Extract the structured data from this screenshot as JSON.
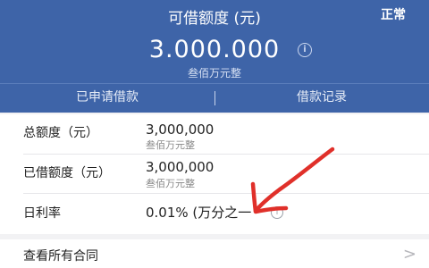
{
  "header": {
    "title": "可借额度 (元)",
    "status": "正常",
    "amount": "3.000.000",
    "amount_words": "叁佰万元整",
    "info_icon": "info-icon"
  },
  "tabs": [
    {
      "label": "已申请借款"
    },
    {
      "label": "借款记录"
    }
  ],
  "details": [
    {
      "label": "总额度（元）",
      "value": "3,000,000",
      "sub": "叁佰万元整"
    },
    {
      "label": "已借额度（元）",
      "value": "3,000,000",
      "sub": "叁佰万元整"
    },
    {
      "label": "日利率",
      "value": "0.01% (万分之一",
      "sub": ""
    }
  ],
  "contracts": {
    "label": "查看所有合同",
    "chevron": ">"
  },
  "colors": {
    "header_bg": "#3e64a8",
    "annotation": "#e0302a"
  }
}
